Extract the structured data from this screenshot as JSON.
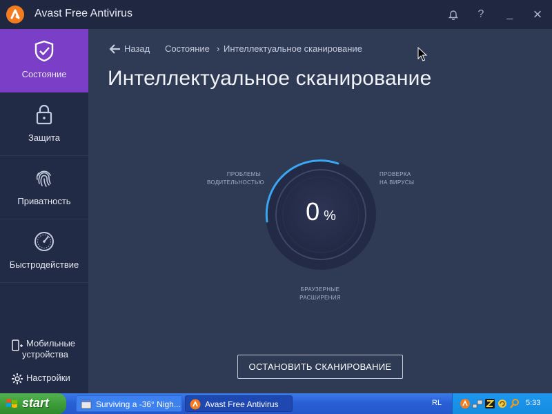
{
  "window": {
    "title": "Avast Free Antivirus",
    "controls": {
      "notifications_icon": "bell-icon",
      "help": "?",
      "minimize": "_",
      "close": "×"
    }
  },
  "sidebar": {
    "items": [
      {
        "label": "Состояние",
        "icon": "shield-check-icon",
        "active": true
      },
      {
        "label": "Защита",
        "icon": "lock-icon",
        "active": false
      },
      {
        "label": "Приватность",
        "icon": "fingerprint-icon",
        "active": false
      },
      {
        "label": "Быстродействие",
        "icon": "speedometer-icon",
        "active": false
      }
    ],
    "mobile": {
      "line1": "Мобильные",
      "line2": "устройства",
      "icon": "mobile-plus-icon"
    },
    "settings": {
      "label": "Настройки",
      "icon": "gear-icon"
    }
  },
  "breadcrumb": {
    "back_label": "Назад",
    "path": "Состояние",
    "separator": "›",
    "current": "Интеллектуальное сканирование"
  },
  "page": {
    "title": "Интеллектуальное сканирование"
  },
  "scan": {
    "progress_percent": 0,
    "progress_display": "0",
    "percent_symbol": "%",
    "labels": {
      "left": {
        "line1": "ПРОБЛЕМЫ",
        "line2": "ВОДИТЕЛЬНОСТЬЮ"
      },
      "right": {
        "line1": "ПРОВЕРКА",
        "line2": "НА ВИРУСЫ"
      },
      "bottom": {
        "line1": "БРАУЗЕРНЫЕ",
        "line2": "РАСШИРЕНИЯ"
      }
    },
    "stop_button": "ОСТАНОВИТЬ СКАНИРОВАНИЕ"
  },
  "taskbar": {
    "start_label": "start",
    "tasks": [
      {
        "label": "Surviving a -36° Nigh...",
        "icon": "browser-icon",
        "active": false
      },
      {
        "label": "Avast Free Antivirus",
        "icon": "avast-icon",
        "active": true
      }
    ],
    "language": "RL",
    "clock": "5:33"
  },
  "colors": {
    "background": "#2f3a55",
    "sidebar": "#222b45",
    "accent_purple": "#7a3fc6",
    "ring_blue": "#3aa7f2",
    "avast_orange": "#f47c20"
  }
}
